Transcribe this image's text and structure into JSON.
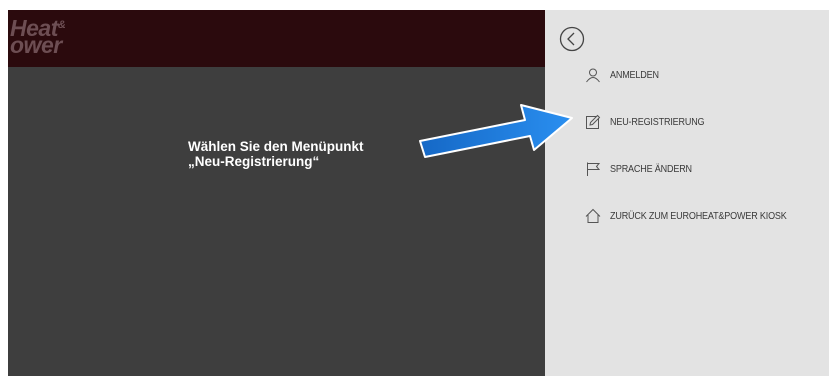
{
  "logo": {
    "line1": "Heat",
    "amp": "&",
    "line2": "ower"
  },
  "instruction": {
    "line1": "Wählen Sie den Menüpunkt",
    "line2": "„Neu-Registrierung“"
  },
  "menu": {
    "items": [
      {
        "label": "ANMELDEN",
        "icon": "user-icon"
      },
      {
        "label": "NEU-REGISTRIERUNG",
        "icon": "edit-icon"
      },
      {
        "label": "SPRACHE ÄNDERN",
        "icon": "flag-icon"
      },
      {
        "label": "ZURÜCK ZUM EUROHEAT&POWER KIOSK",
        "icon": "home-icon"
      }
    ]
  },
  "colors": {
    "topbar": "#2b0a0d",
    "content_bg": "#3e3e3e",
    "panel_bg": "#e3e3e3",
    "arrow": "#1e7fe0"
  }
}
